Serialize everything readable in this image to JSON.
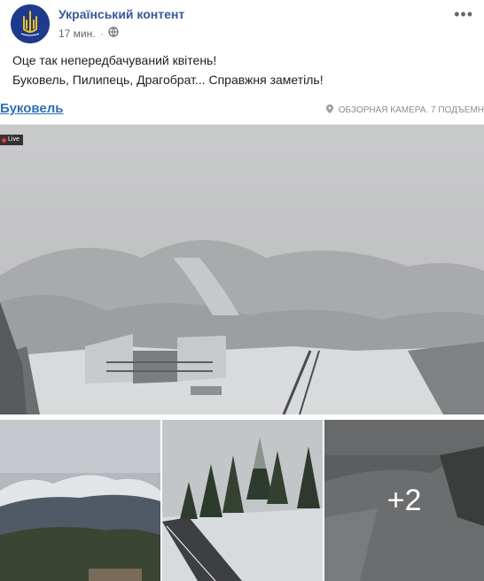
{
  "post": {
    "page_name": "Український контент",
    "timestamp": "17 мин.",
    "privacy_icon": "globe-icon",
    "more_icon": "ellipsis-icon",
    "text_line_1": "Оце так непередбачуваний квітень!",
    "text_line_2": "Буковель, Пилипець, Драгобрат... Справжня заметіль!"
  },
  "main_photo": {
    "cam_title": "Буковель",
    "cam_location": "ОБЗОРНАЯ КАМЕРА. 7 ПОДЪЕМН",
    "live_label": "Live",
    "location_icon": "location-pin-icon"
  },
  "gallery": {
    "more_count": "+2"
  },
  "colors": {
    "link": "#385898",
    "cam_title": "#2d6fb4",
    "avatar": "#1e3a8c"
  }
}
